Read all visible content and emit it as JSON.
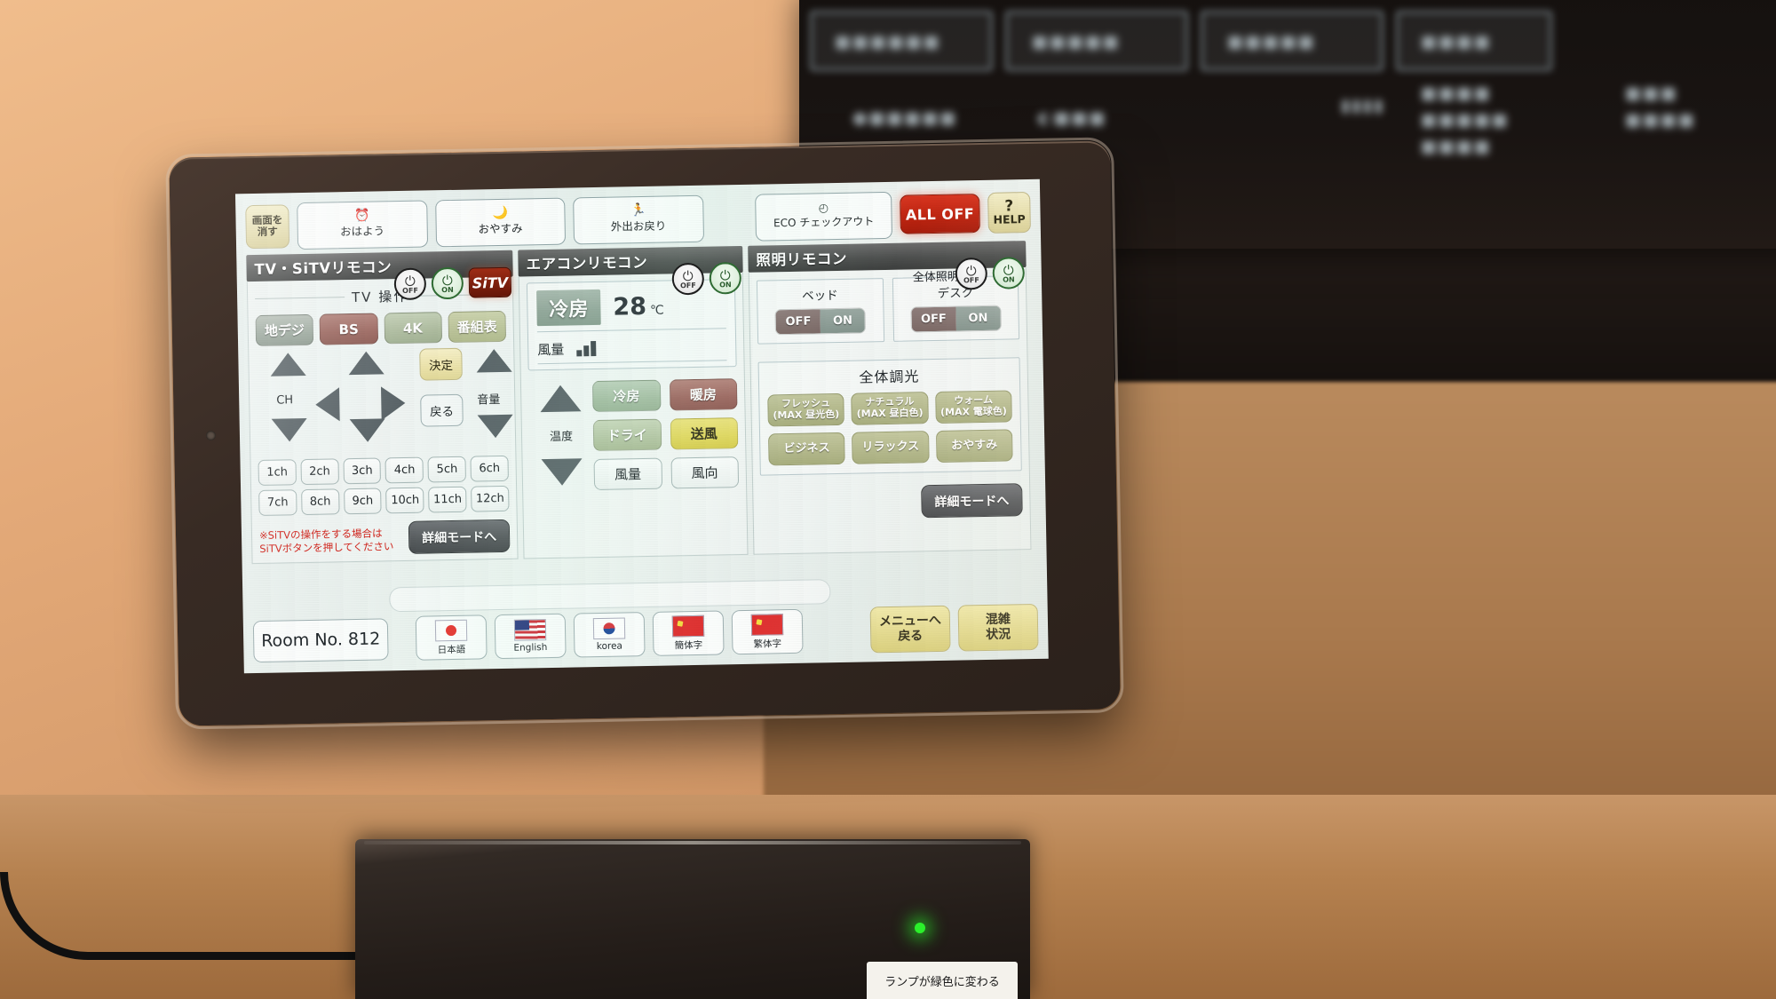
{
  "topbar": {
    "screen_off": {
      "line1": "画面を",
      "line2": "消す"
    },
    "scenes": [
      {
        "icon": "alarm-clock-icon",
        "glyph": "⏰",
        "label": "おはよう"
      },
      {
        "icon": "moon-icon",
        "glyph": "🌙",
        "label": "おやすみ"
      },
      {
        "icon": "exit-person-icon",
        "glyph": "🏃",
        "label": "外出お戻り"
      }
    ],
    "eco": {
      "icon": "clock-icon",
      "glyph": "🕐",
      "label": "ECO チェックアウト"
    },
    "all_off": "ALL OFF",
    "help": {
      "mark": "?",
      "label": "HELP"
    }
  },
  "tv_panel": {
    "title": "TV・SiTVリモコン",
    "power_off": "OFF",
    "power_on": "ON",
    "sitv": "SiTV",
    "section_label": "TV 操作",
    "sources": [
      {
        "label": "地デジ",
        "style": "src-gray"
      },
      {
        "label": "BS",
        "style": "src-red"
      },
      {
        "label": "4K",
        "style": "src-green"
      },
      {
        "label": "番組表",
        "style": "src-olive"
      }
    ],
    "ch_label": "CH",
    "vol_label": "音量",
    "ok": "決定",
    "back": "戻る",
    "channels": [
      "1ch",
      "2ch",
      "3ch",
      "4ch",
      "5ch",
      "6ch",
      "7ch",
      "8ch",
      "9ch",
      "10ch",
      "11ch",
      "12ch"
    ],
    "note_line1": "※SiTVの操作をする場合は",
    "note_line2": "SiTVボタンを押してください",
    "detail_button": "詳細モードへ"
  },
  "ac_panel": {
    "title": "エアコンリモコン",
    "power_off": "OFF",
    "power_on": "ON",
    "status_mode": "冷房",
    "status_temp": "28",
    "status_unit": "℃",
    "fan_label": "風量",
    "fan_level": 2,
    "temp_label": "温度",
    "modes": [
      {
        "label": "冷房",
        "style": "m-cool"
      },
      {
        "label": "暖房",
        "style": "m-heat"
      },
      {
        "label": "ドライ",
        "style": "m-dry"
      },
      {
        "label": "送風",
        "style": "m-fan"
      },
      {
        "label": "風量",
        "style": "m-plain"
      },
      {
        "label": "風向",
        "style": "m-plain"
      }
    ]
  },
  "light_panel": {
    "title": "照明リモコン",
    "all_light_label": "全体照明",
    "power_off": "OFF",
    "power_on": "ON",
    "zones": [
      {
        "name": "ベッド",
        "off": "OFF",
        "on": "ON"
      },
      {
        "name": "デスク",
        "off": "OFF",
        "on": "ON"
      }
    ],
    "dim_title": "全体調光",
    "presets": [
      {
        "line1": "フレッシュ",
        "line2": "(MAX 昼光色)"
      },
      {
        "line1": "ナチュラル",
        "line2": "(MAX 昼白色)"
      },
      {
        "line1": "ウォーム",
        "line2": "(MAX 電球色)"
      },
      {
        "line1": "ビジネス",
        "line2": ""
      },
      {
        "line1": "リラックス",
        "line2": ""
      },
      {
        "line1": "おやすみ",
        "line2": ""
      }
    ],
    "detail_button": "詳細モードへ"
  },
  "bottom": {
    "room": "Room No. 812",
    "languages": [
      {
        "name": "日本語",
        "flag": "flag-jp"
      },
      {
        "name": "English",
        "flag": "flag-us"
      },
      {
        "name": "korea",
        "flag": "flag-kr"
      },
      {
        "name": "簡体字",
        "flag": "flag-cn"
      },
      {
        "name": "繁体字",
        "flag": "flag-cn"
      }
    ],
    "menu_back": {
      "line1": "メニューへ",
      "line2": "戻る"
    },
    "crowd": {
      "line1": "混雑",
      "line2": "状況"
    }
  },
  "dock": {
    "label": "ランプが緑色に変わる"
  },
  "colors": {
    "accent_red": "#bf2410",
    "accent_yellow": "#e3da8c",
    "panel_header": "#4d4f4e",
    "power_on_green": "#2f6b33"
  }
}
